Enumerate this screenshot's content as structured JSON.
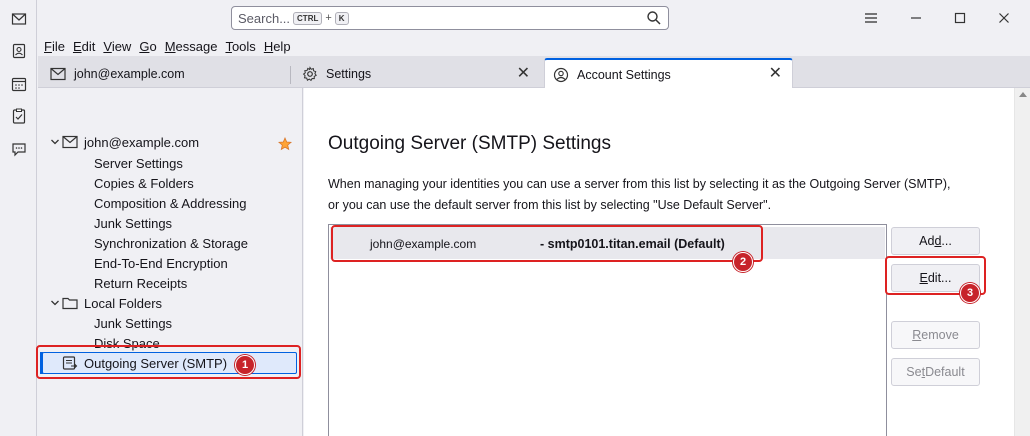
{
  "search": {
    "placeholder": "Search...",
    "key_ctrl": "CTRL",
    "key_plus": "+",
    "key_k": "K"
  },
  "menu": [
    "File",
    "Edit",
    "View",
    "Go",
    "Message",
    "Tools",
    "Help"
  ],
  "tabs": [
    {
      "label": "john@example.com",
      "icon": "mail-icon"
    },
    {
      "label": "Settings",
      "icon": "gear-icon"
    },
    {
      "label": "Account Settings",
      "icon": "account-icon"
    }
  ],
  "tree": {
    "account": "john@example.com",
    "account_items": [
      "Server Settings",
      "Copies & Folders",
      "Composition & Addressing",
      "Junk Settings",
      "Synchronization & Storage",
      "End-To-End Encryption",
      "Return Receipts"
    ],
    "local_folders": "Local Folders",
    "local_items": [
      "Junk Settings",
      "Disk Space"
    ],
    "outgoing": "Outgoing Server (SMTP)"
  },
  "main": {
    "heading": "Outgoing Server (SMTP) Settings",
    "desc_line1": "When managing your identities you can use a server from this list by selecting it as the Outgoing Server (SMTP),",
    "desc_line2": "or you can use the default server from this list by selecting \"Use Default Server\".",
    "server_user": "john@example.com",
    "server_host": "- smtp0101.titan.email (Default)"
  },
  "buttons": {
    "add_pre": "Ad",
    "add_u": "d",
    "add_post": "...",
    "edit_u": "E",
    "edit_post": "dit...",
    "remove_u": "R",
    "remove_post": "emove",
    "setdefault_pre": "Se",
    "setdefault_u": "t",
    "setdefault_post": " Default"
  },
  "annotations": [
    "1",
    "2",
    "3"
  ],
  "colors": {
    "accent": "#0061e0",
    "annotation": "#d22222"
  }
}
